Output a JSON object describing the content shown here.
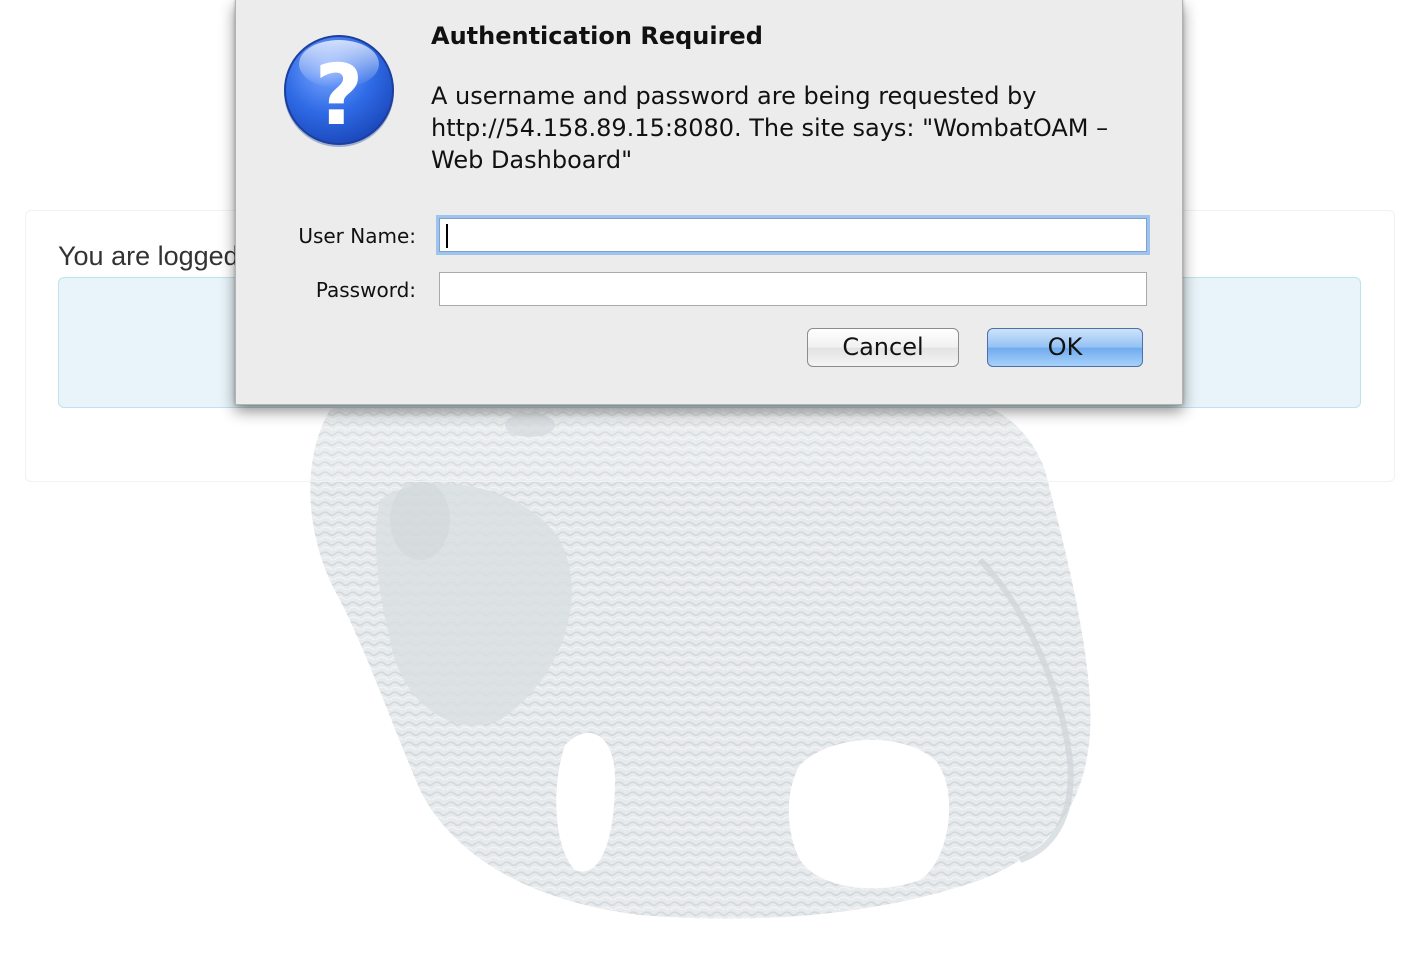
{
  "background": {
    "logged_in_text": "You are logged",
    "watermark_icon": "wombat-watermark"
  },
  "dialog": {
    "icon": "question-icon",
    "title": "Authentication Required",
    "message": "A username and password are being requested by http://54.158.89.15:8080. The site says: \"WombatOAM – Web Dashboard\"",
    "username_label": "User Name:",
    "username_value": "",
    "password_label": "Password:",
    "password_value": "",
    "cancel_label": "Cancel",
    "ok_label": "OK"
  },
  "colors": {
    "dialog_bg": "#ececec",
    "info_box_bg": "#e8f4f9",
    "ok_button": "#6eaaee",
    "focus_ring": "#9ec3ee"
  }
}
